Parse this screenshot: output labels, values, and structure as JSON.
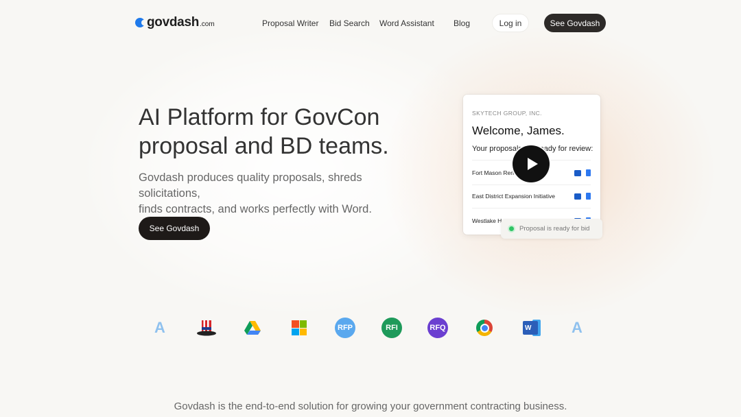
{
  "nav": {
    "logo_text": "govdash",
    "logo_domain": ".com",
    "links": [
      "Proposal Writer",
      "Bid Search",
      "Word Assistant",
      "Blog"
    ],
    "login_label": "Log in",
    "cta_label": "See Govdash"
  },
  "hero": {
    "title_line1": "AI Platform for GovCon",
    "title_line2": "proposal and BD teams.",
    "subtitle_line1": "Govdash produces quality proposals, shreds solicitations,",
    "subtitle_line2": "finds contracts, and works perfectly with Word.",
    "cta_label": "See Govdash"
  },
  "card": {
    "company": "SKYTECH GROUP, INC.",
    "welcome": "Welcome, James.",
    "prompt": "Your proposals are ready for review:",
    "rows": [
      "Fort Mason Renovation",
      "East District Expansion Initiative",
      "Westlake Housing"
    ],
    "toast": "Proposal is ready for bid"
  },
  "integrations": {
    "items": [
      "A",
      "uncle-sam-hat",
      "google-drive",
      "microsoft",
      "RFP",
      "RFI",
      "RFQ",
      "chrome",
      "word",
      "A"
    ],
    "colors": {
      "rfp": "#5aa8ee",
      "rfi": "#1e9a5a",
      "rfq": "#6b3fd0"
    }
  },
  "footer": {
    "tagline": "Govdash is the end-to-end solution for growing your government contracting business."
  },
  "colors": {
    "accent": "#1f7aeb",
    "dark_button": "#2d2a28",
    "success": "#2fc465"
  }
}
